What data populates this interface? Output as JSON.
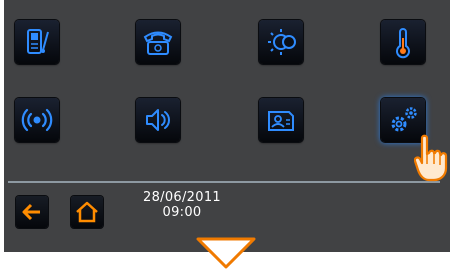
{
  "icons": {
    "videophone": "videophone-icon",
    "telephone": "telephone-icon",
    "lighting": "lighting-icon",
    "thermometer": "thermometer-icon",
    "alarm": "alarm-signal-icon",
    "volume": "volume-icon",
    "contact_card": "contact-card-icon",
    "settings": "gears-icon",
    "back": "back-arrow-icon",
    "home": "home-icon",
    "pointer": "hand-pointer-icon",
    "scroll_down": "down-arrow-icon"
  },
  "status": {
    "date": "28/06/2011",
    "time": "09:00"
  },
  "colors": {
    "panel_bg": "#414244",
    "tile_bg": "#0b0f16",
    "icon_blue": "#2f8cff",
    "nav_orange": "#ff8c00",
    "divider": "#8d99a2"
  }
}
